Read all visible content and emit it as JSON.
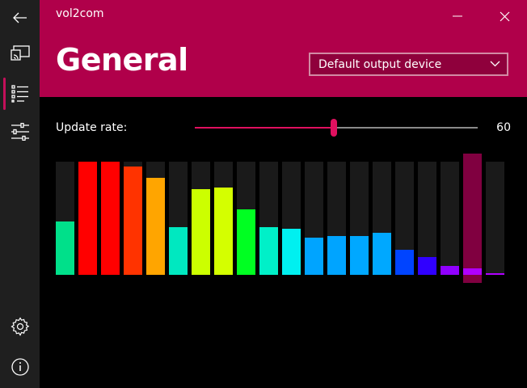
{
  "window": {
    "title": "vol2com"
  },
  "page": {
    "title": "General"
  },
  "device_select": {
    "selected": "Default output device"
  },
  "update_rate": {
    "label": "Update rate:",
    "value": "60",
    "slider_fraction": 0.49
  },
  "nav": {
    "items": [
      {
        "name": "back-icon"
      },
      {
        "name": "cast-icon"
      },
      {
        "name": "list-icon",
        "active": true
      },
      {
        "name": "sliders-icon"
      }
    ],
    "bottom_items": [
      {
        "name": "gear-icon"
      },
      {
        "name": "info-icon"
      }
    ]
  },
  "colors": {
    "accent": "#b0004a",
    "accent_bright": "#e0105f",
    "sidebar": "#1f1f1f"
  },
  "spectrum": {
    "levels": [
      0.47,
      1.0,
      1.0,
      0.96,
      0.86,
      0.42,
      0.76,
      0.77,
      0.58,
      0.42,
      0.41,
      0.33,
      0.34,
      0.34,
      0.37,
      0.22,
      0.16,
      0.08,
      0.06,
      0.01
    ],
    "colors": [
      "#00e08a",
      "#ff0000",
      "#ff0000",
      "#ff3300",
      "#ffa500",
      "#00e8c0",
      "#ccff00",
      "#d4ff00",
      "#00ff22",
      "#00f0c8",
      "#00f0f0",
      "#00a4ff",
      "#00a4ff",
      "#00a8ff",
      "#00a8ff",
      "#0044ff",
      "#3000ff",
      "#9000ff",
      "#b000ff",
      "#b000ff"
    ],
    "highlight_index": 18
  }
}
